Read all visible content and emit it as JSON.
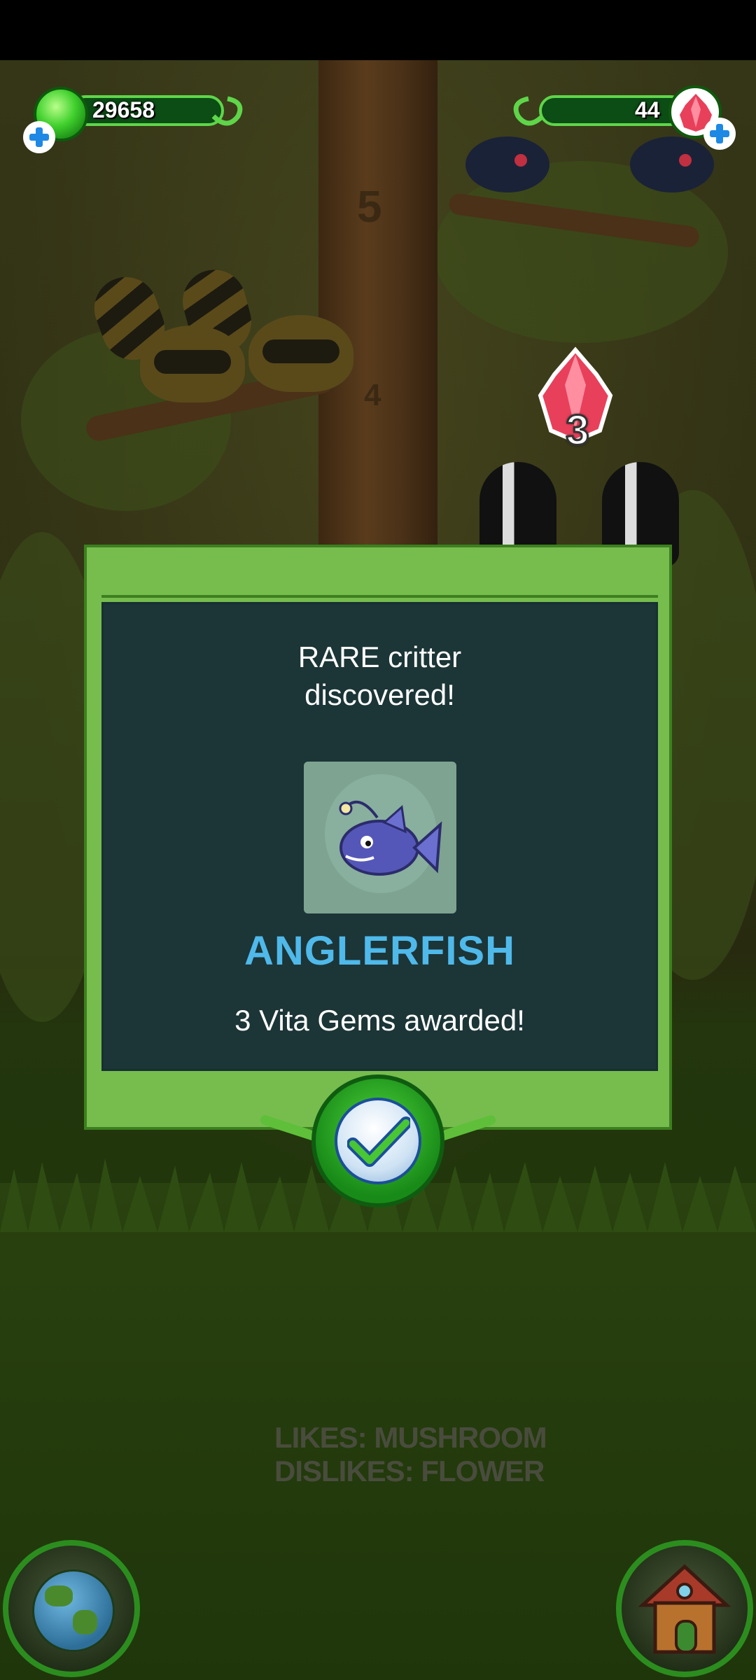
{
  "hud": {
    "vita_gem_count": "29658",
    "crystal_count": "44"
  },
  "scene": {
    "trunk_number_upper": "5",
    "trunk_number_lower": "4",
    "floating_reward": "3",
    "critter_hint": "LIKES: MUSHROOM\nDISLIKES: FLOWER"
  },
  "dialog": {
    "title": "RARE critter\ndiscovered!",
    "critter_name": "ANGLERFISH",
    "award_message": "3 Vita Gems awarded!"
  },
  "icons": {
    "confirm": "checkmark-icon",
    "world": "globe-icon",
    "home": "treehouse-icon"
  },
  "colors": {
    "dialog_frame": "#76bd4e",
    "dialog_panel": "#1c3537",
    "critter_name": "#4fb9ea",
    "hud_accent": "#5fd54a"
  }
}
